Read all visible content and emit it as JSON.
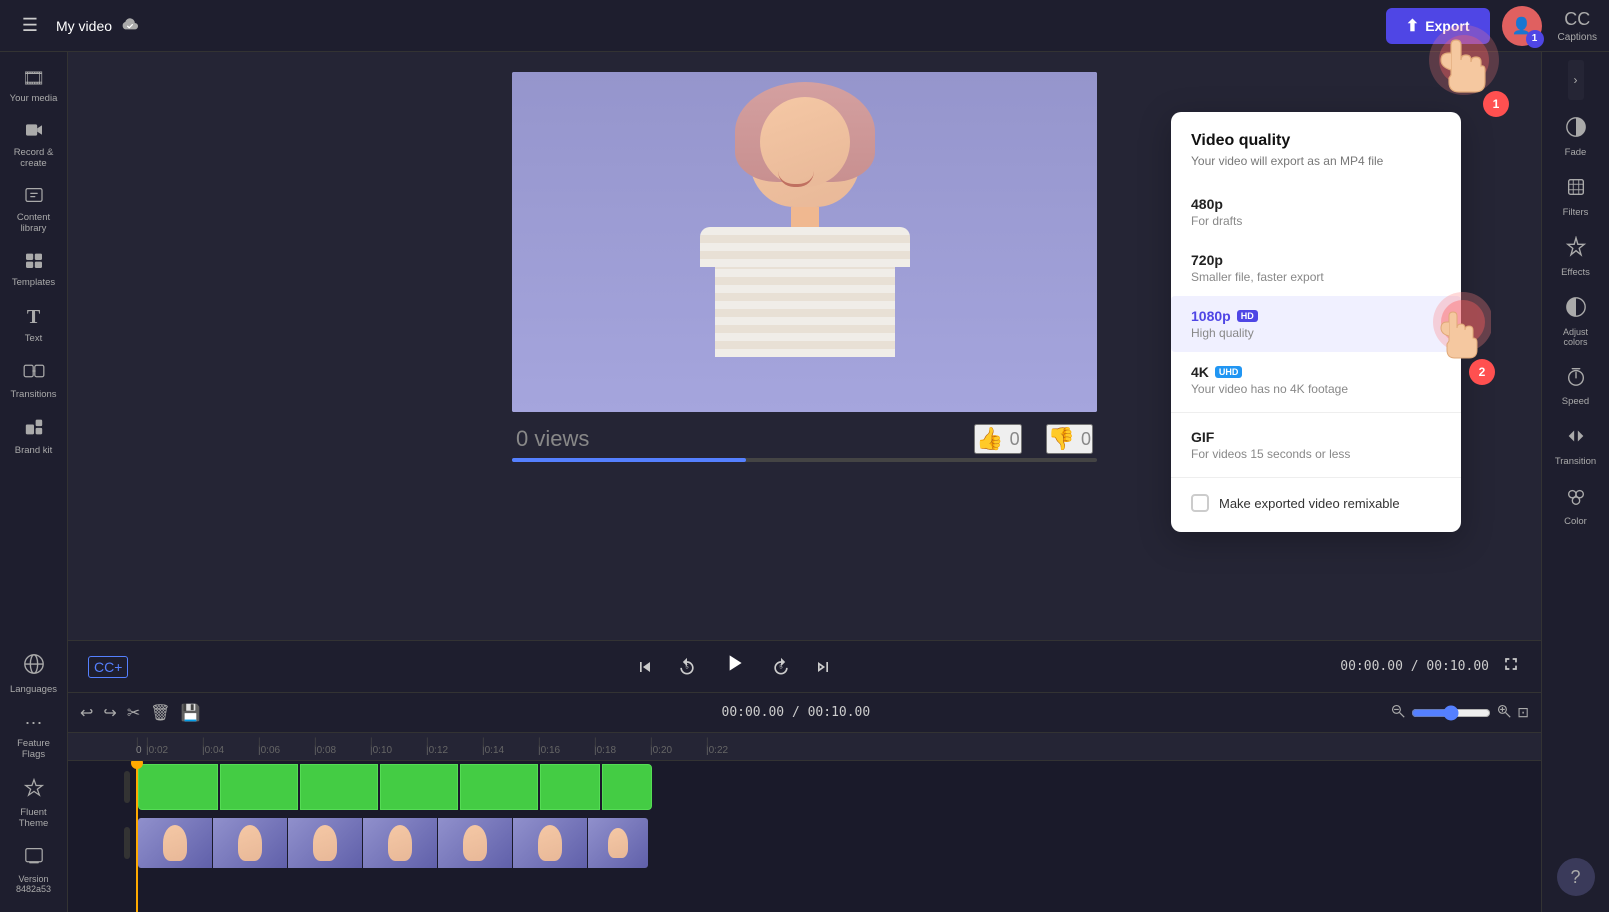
{
  "topbar": {
    "menu_icon": "☰",
    "title": "My video",
    "cloud_icon": "☁",
    "export_label": "Export",
    "upload_icon": "⬆",
    "captions_label": "Captions",
    "badge_number": "1"
  },
  "left_sidebar": {
    "items": [
      {
        "id": "your-media",
        "icon": "🎞",
        "label": "Your media"
      },
      {
        "id": "record-create",
        "icon": "🎥",
        "label": "Record &\ncreate"
      },
      {
        "id": "content-library",
        "icon": "📚",
        "label": "Content\nlibrary"
      },
      {
        "id": "templates",
        "icon": "🗂",
        "label": "Templates"
      },
      {
        "id": "text",
        "icon": "T",
        "label": "Text"
      },
      {
        "id": "transitions",
        "icon": "⬡",
        "label": "Transitions"
      },
      {
        "id": "brand-kit",
        "icon": "🎨",
        "label": "Brand kit"
      },
      {
        "id": "languages",
        "icon": "🌐",
        "label": "Languages"
      },
      {
        "id": "feature-flags",
        "icon": "⋯",
        "label": "Feature\nFlags"
      },
      {
        "id": "fluent-theme",
        "icon": "✦",
        "label": "Fluent\nTheme"
      },
      {
        "id": "version",
        "icon": "🖥",
        "label": "Version\n8482a53"
      }
    ]
  },
  "right_sidebar": {
    "items": [
      {
        "id": "fade",
        "icon": "◑",
        "label": "Fade"
      },
      {
        "id": "filters",
        "icon": "⊟",
        "label": "Filters"
      },
      {
        "id": "effects",
        "icon": "✦",
        "label": "Effects"
      },
      {
        "id": "adjust-colors",
        "icon": "◐",
        "label": "Adjust\ncolors"
      },
      {
        "id": "speed",
        "icon": "⏱",
        "label": "Speed"
      },
      {
        "id": "transition",
        "icon": "⇄",
        "label": "Transition"
      },
      {
        "id": "color",
        "icon": "🎨",
        "label": "Color"
      }
    ]
  },
  "video": {
    "views_label": "0 views",
    "likes": "0",
    "dislikes": "0"
  },
  "playback": {
    "cc_label": "CC+",
    "time_current": "00:00.00",
    "time_total": "00:10.00",
    "time_display": "00:00.00 / 00:10.00"
  },
  "timeline": {
    "time_display": "00:00.00 / 00:10.00",
    "ruler_ticks": [
      "0",
      "|0:02",
      "|0:04",
      "|0:06",
      "|0:08",
      "|0:10",
      "|0:12",
      "|0:14",
      "|0:16",
      "|0:18",
      "|0:20",
      "|0:22"
    ]
  },
  "quality_popup": {
    "title": "Video quality",
    "subtitle": "Your video will export as an MP4 file",
    "options": [
      {
        "id": "480p",
        "name": "480p",
        "desc": "For drafts",
        "badge": "",
        "selected": false
      },
      {
        "id": "720p",
        "name": "720p",
        "desc": "Smaller file, faster export",
        "badge": "",
        "selected": false
      },
      {
        "id": "1080p",
        "name": "1080p",
        "badge_type": "hd",
        "badge_text": "HD",
        "desc": "High quality",
        "selected": true
      },
      {
        "id": "4k",
        "name": "4K",
        "badge_type": "uhd",
        "badge_text": "UHD",
        "desc": "Your video has no 4K footage",
        "selected": false
      },
      {
        "id": "gif",
        "name": "GIF",
        "desc": "For videos 15 seconds or less",
        "badge": "",
        "selected": false
      }
    ],
    "remixable_label": "Make exported video remixable"
  },
  "cursor": {
    "hand1_badge": "1",
    "hand2_badge": "2"
  }
}
